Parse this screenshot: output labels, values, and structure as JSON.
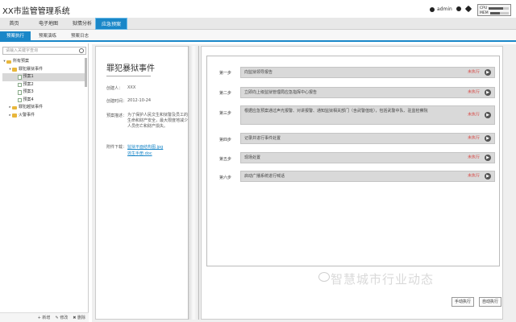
{
  "app": {
    "title": "XX市监管管理系统",
    "user": "admin",
    "meter": {
      "cpu_label": "CPU",
      "mem_label": "MEM",
      "cpu_level": 0.7,
      "mem_level": 0.55
    }
  },
  "nav": {
    "items": [
      {
        "label": "首页"
      },
      {
        "label": "电子地图"
      },
      {
        "label": "狱情分析"
      },
      {
        "label": "应急预案"
      }
    ],
    "active_index": 3
  },
  "subnav": {
    "items": [
      {
        "label": "预案执行"
      },
      {
        "label": "预案演练"
      },
      {
        "label": "预案日志"
      }
    ],
    "active_index": 0
  },
  "tree": {
    "search_placeholder": "请输入关键字查询",
    "nodes": [
      {
        "label": "所有预案",
        "type": "folder",
        "level": 0,
        "toggle": "-"
      },
      {
        "label": "罪犯暴狱事件",
        "type": "folder",
        "level": 1,
        "toggle": "-"
      },
      {
        "label": "预案1",
        "type": "doc",
        "level": 2,
        "selected": true
      },
      {
        "label": "预案2",
        "type": "doc",
        "level": 2
      },
      {
        "label": "预案3",
        "type": "doc",
        "level": 2
      },
      {
        "label": "预案4",
        "type": "doc",
        "level": 2
      },
      {
        "label": "罪犯越狱事件",
        "type": "folder",
        "level": 1,
        "toggle": "+"
      },
      {
        "label": "火警事件",
        "type": "folder",
        "level": 1,
        "toggle": "+"
      }
    ],
    "footer": {
      "add": "+ 新增",
      "edit": "✎ 修改",
      "delete": "✖ 删除"
    }
  },
  "event": {
    "title": "罪犯暴狱事件",
    "creator_label": "创建人：",
    "creator": "XXX",
    "created_label": "创建时间：",
    "created": "2012-10-24",
    "desc_label": "预案描述：",
    "desc": "为了保护人民文生和狱警及员工的生命和财产安全，最大限度地减少人员伤亡和财产损失。",
    "attach_label": "附件下载：",
    "attachments": [
      "监狱平面结构图.jpg",
      "逃生手册.doc"
    ]
  },
  "steps": [
    {
      "label": "第一步",
      "text": "向监狱领导报告",
      "status": "未执行"
    },
    {
      "label": "第二步",
      "text": "立即向上级监狱管理局应急指挥中心报告",
      "status": "未执行"
    },
    {
      "label": "第三步",
      "text": "根据应急预案通过声光报警、对讲报警、通知监狱相关部门（含武警值班），包括武警中队、驻监检察院",
      "status": "未执行"
    },
    {
      "label": "第四步",
      "text": "记录并进行事件处置",
      "status": "未执行"
    },
    {
      "label": "第五步",
      "text": "现场处置",
      "status": "未执行"
    },
    {
      "label": "第六步",
      "text": "启动广播系统进行喊话",
      "status": "未执行"
    }
  ],
  "actions": {
    "manual": "手动执行",
    "auto": "自动执行"
  },
  "watermark": "智慧城市行业动态"
}
